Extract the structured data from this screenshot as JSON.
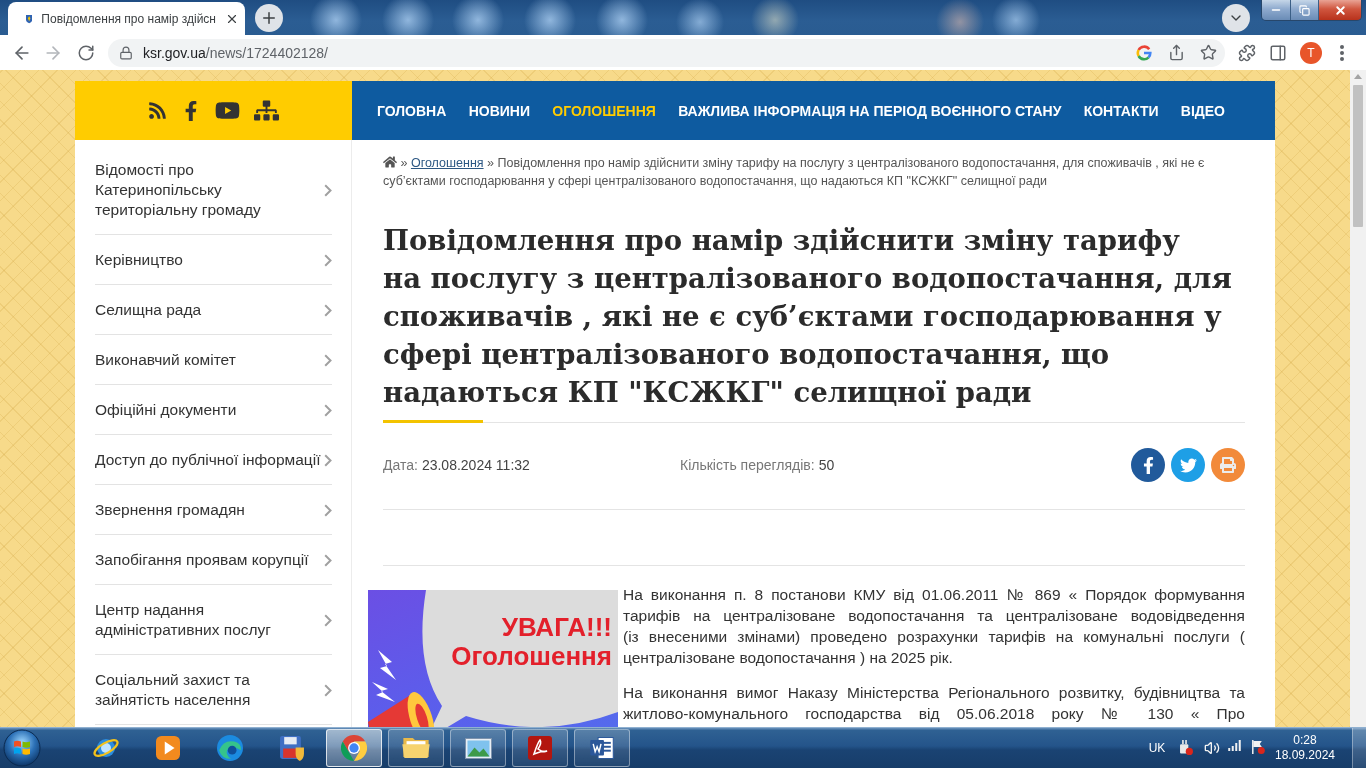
{
  "browser": {
    "tab_title": "Повідомлення про намір здійсн",
    "url_host": "ksr.gov.ua",
    "url_path": "/news/1724402128/",
    "profile_initial": "T"
  },
  "header": {
    "nav": [
      {
        "label": "ГОЛОВНА",
        "selected": false
      },
      {
        "label": "НОВИНИ",
        "selected": false
      },
      {
        "label": "ОГОЛОШЕННЯ",
        "selected": true
      },
      {
        "label": "ВАЖЛИВА ІНФОРМАЦІЯ НА ПЕРІОД ВОЄННОГО СТАНУ",
        "selected": false
      },
      {
        "label": "КОНТАКТИ",
        "selected": false
      },
      {
        "label": "ВІДЕО",
        "selected": false
      }
    ]
  },
  "sidebar": {
    "items": [
      "Відомості про Катеринопільську територіальну громаду",
      "Керівництво",
      "Селищна рада",
      "Виконавчий комітет",
      "Офіційні документи",
      "Доступ до публічної інформації",
      "Звернення громадян",
      "Запобігання проявам корупції",
      "Центр надання адміністративних послуг",
      "Соціальний захист та зайнятість населення"
    ]
  },
  "breadcrumb": [
    {
      "kind": "home"
    },
    {
      "kind": "link",
      "separator": "»",
      "label": "Оголошення"
    },
    {
      "kind": "current",
      "separator": "»",
      "label": "Повідомлення про намір здійснити зміну тарифу на послугу з централізованого водопостачання, для споживачів , які не є суб’єктами господарювання у сфері централізованого водопостачання, що надаються КП \"КСЖКГ\" селищної ради"
    }
  ],
  "article": {
    "title_lines": [
      "Повідомлення про намір здійснити зміну тарифу",
      "на послугу з централізованого водопостачання, для",
      "споживачів , які не є суб’єктами господарювання у",
      "сфері централізованого водопостачання, що",
      "надаються КП \"КСЖКГ\" селищної ради"
    ],
    "date_label": "Дата:",
    "date": "23.08.2024 11:32",
    "views_label": "Кількість переглядів:",
    "views": "50",
    "banner_lines": [
      "УВАГА!!!",
      "Оголошення"
    ],
    "paragraphs": [
      {
        "lines": [
          "На виконання п. 8 постанови КМУ від 01.06.2011 № 869 « Порядок формування",
          "тарифів на централізоване водопостачання та централізоване водовідведення",
          "(із внесеними змінами) проведено розрахунки тарифів на комунальні послуги (",
          "централізоване водопостачання ) на 2025 рік."
        ],
        "continues": false
      },
      {
        "lines": [
          "На виконання вимог Наказу Міністерства Регіонального розвитку, будівництва та",
          "житлово-комунального господарства від 05.06.2018 року № 130 « Про"
        ],
        "continues": true
      }
    ]
  },
  "taskbar": {
    "apps": [
      {
        "kind": "ie",
        "running": false,
        "selected": false
      },
      {
        "kind": "media",
        "running": false,
        "selected": false
      },
      {
        "kind": "edge",
        "running": false,
        "selected": false
      },
      {
        "kind": "backup",
        "running": false,
        "selected": false
      },
      {
        "kind": "chrome",
        "running": true,
        "selected": true
      },
      {
        "kind": "explorer",
        "running": true,
        "selected": false
      },
      {
        "kind": "photos",
        "running": true,
        "selected": false
      },
      {
        "kind": "acrobat",
        "running": true,
        "selected": false
      },
      {
        "kind": "word",
        "running": true,
        "selected": false
      }
    ],
    "language": "UK",
    "time": "0:28",
    "date": "18.09.2024"
  }
}
